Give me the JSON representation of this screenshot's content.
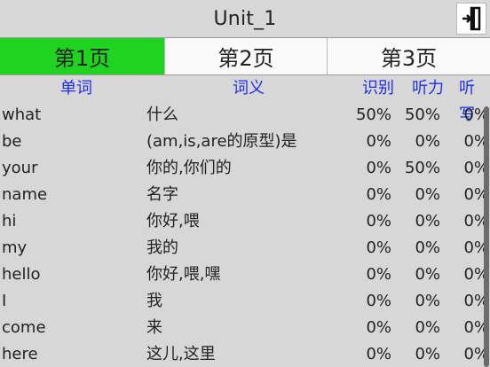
{
  "header": {
    "title": "Unit_1",
    "exit_icon": "exit-door-icon"
  },
  "tabs": [
    {
      "label": "第1页",
      "active": true
    },
    {
      "label": "第2页",
      "active": false
    },
    {
      "label": "第3页",
      "active": false
    }
  ],
  "columns": {
    "word": "单词",
    "meaning": "词义",
    "recognize": "识别",
    "listen": "听力",
    "write": "听写"
  },
  "rows": [
    {
      "word": "what",
      "meaning": "什么",
      "recognize": "50%",
      "listen": "50%",
      "write": "0%"
    },
    {
      "word": "be",
      "meaning": "(am,is,are的原型)是",
      "recognize": "0%",
      "listen": "0%",
      "write": "0%"
    },
    {
      "word": "your",
      "meaning": "你的,你们的",
      "recognize": "0%",
      "listen": "50%",
      "write": "0%"
    },
    {
      "word": "name",
      "meaning": "名字",
      "recognize": "0%",
      "listen": "0%",
      "write": "0%"
    },
    {
      "word": "hi",
      "meaning": "你好,喂",
      "recognize": "0%",
      "listen": "0%",
      "write": "0%"
    },
    {
      "word": "my",
      "meaning": "我的",
      "recognize": "0%",
      "listen": "0%",
      "write": "0%"
    },
    {
      "word": "hello",
      "meaning": "你好,喂,嘿",
      "recognize": "0%",
      "listen": "0%",
      "write": "0%"
    },
    {
      "word": "I",
      "meaning": "我",
      "recognize": "0%",
      "listen": "0%",
      "write": "0%"
    },
    {
      "word": "come",
      "meaning": "来",
      "recognize": "0%",
      "listen": "0%",
      "write": "0%"
    },
    {
      "word": "here",
      "meaning": "这儿,这里",
      "recognize": "0%",
      "listen": "0%",
      "write": "0%"
    }
  ],
  "colors": {
    "active_tab": "#20d320",
    "header_text": "#1e2ee8",
    "background": "#d7d7d7"
  }
}
